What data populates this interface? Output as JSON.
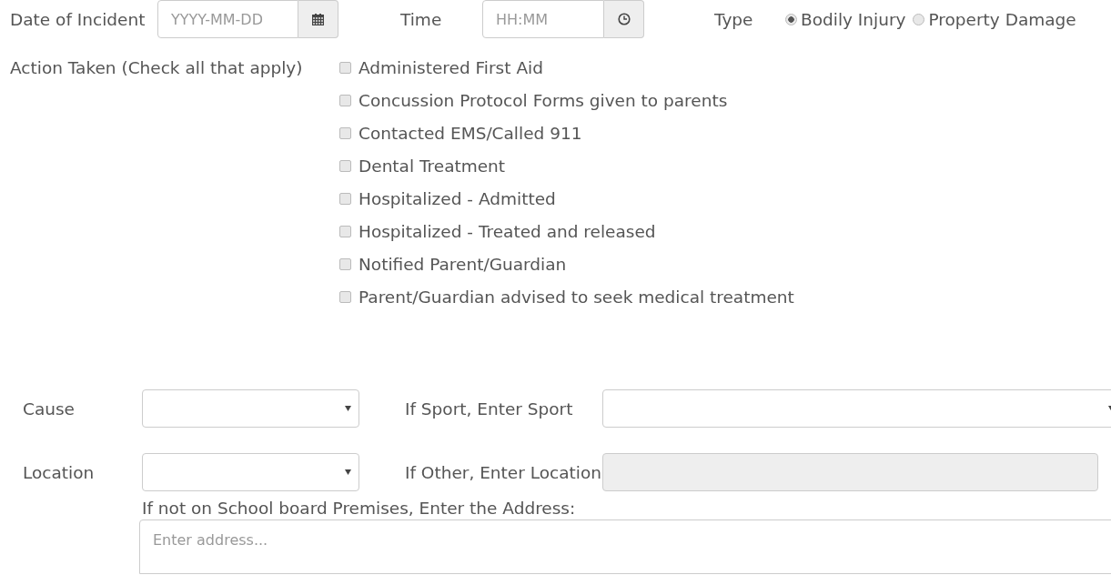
{
  "date_field": {
    "label": "Date of Incident",
    "placeholder": "YYYY-MM-DD"
  },
  "time_field": {
    "label": "Time",
    "placeholder": "HH:MM"
  },
  "type": {
    "label": "Type",
    "options": [
      {
        "label": "Bodily Injury",
        "selected": true
      },
      {
        "label": "Property Damage",
        "selected": false
      }
    ]
  },
  "actions": {
    "label": "Action Taken (Check all that apply)",
    "items": [
      {
        "label": "Administered First Aid",
        "checked": false
      },
      {
        "label": "Concussion Protocol Forms given to parents",
        "checked": false
      },
      {
        "label": "Contacted EMS/Called 911",
        "checked": false
      },
      {
        "label": "Dental Treatment",
        "checked": false
      },
      {
        "label": "Hospitalized - Admitted",
        "checked": false
      },
      {
        "label": "Hospitalized - Treated and released",
        "checked": false
      },
      {
        "label": "Notified Parent/Guardian",
        "checked": false
      },
      {
        "label": "Parent/Guardian advised to seek medical treatment",
        "checked": false
      }
    ]
  },
  "cause": {
    "label": "Cause"
  },
  "sport": {
    "label": "If Sport, Enter Sport"
  },
  "location": {
    "label": "Location"
  },
  "other_location": {
    "label": "If Other, Enter Location",
    "disabled": true
  },
  "address": {
    "label": "If not on School board Premises, Enter the Address:",
    "placeholder": "Enter address..."
  }
}
